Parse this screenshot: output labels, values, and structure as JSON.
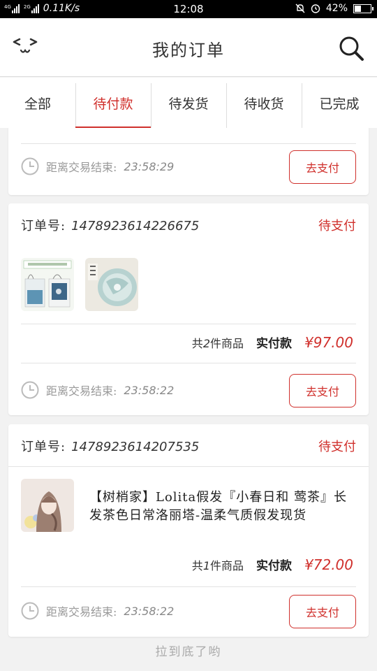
{
  "status_bar": {
    "network_label": "4G",
    "sim2_label": "2G",
    "speed": "0.11K/s",
    "time": "12:08",
    "battery": "42%",
    "battery_level": 0.42
  },
  "header": {
    "title": "我的订单",
    "back_icon": "back-face-icon",
    "search_icon": "search-icon"
  },
  "tabs": [
    {
      "label": "全部",
      "active": false
    },
    {
      "label": "待付款",
      "active": true
    },
    {
      "label": "待发货",
      "active": false
    },
    {
      "label": "待收货",
      "active": false
    },
    {
      "label": "已完成",
      "active": false
    }
  ],
  "orders": [
    {
      "timer_label": "距离交易结束:",
      "timer_value": "23:58:29",
      "pay_label": "去支付"
    },
    {
      "order_no_label": "订单号:",
      "order_no": "1478923614226675",
      "status": "待支付",
      "images": [
        "tote-bag-product-image",
        "tea-plate-product-image"
      ],
      "count_prefix": "共",
      "count": "2",
      "count_suffix": "件商品",
      "paid_label": "实付款",
      "amount": "¥97.00",
      "timer_label": "距离交易结束:",
      "timer_value": "23:58:22",
      "pay_label": "去支付"
    },
    {
      "order_no_label": "订单号:",
      "order_no": "1478923614207535",
      "status": "待支付",
      "images": [
        "wig-product-image"
      ],
      "title": "【树梢家】Lolita假发『小春日和 莺茶』长发茶色日常洛丽塔-温柔气质假发现货",
      "count_prefix": "共",
      "count": "1",
      "count_suffix": "件商品",
      "paid_label": "实付款",
      "amount": "¥72.00",
      "timer_label": "距离交易结束:",
      "timer_value": "23:58:22",
      "pay_label": "去支付"
    }
  ],
  "footer": "拉到底了哟",
  "colors": {
    "accent": "#d0302c",
    "background": "#f2f2f2"
  }
}
